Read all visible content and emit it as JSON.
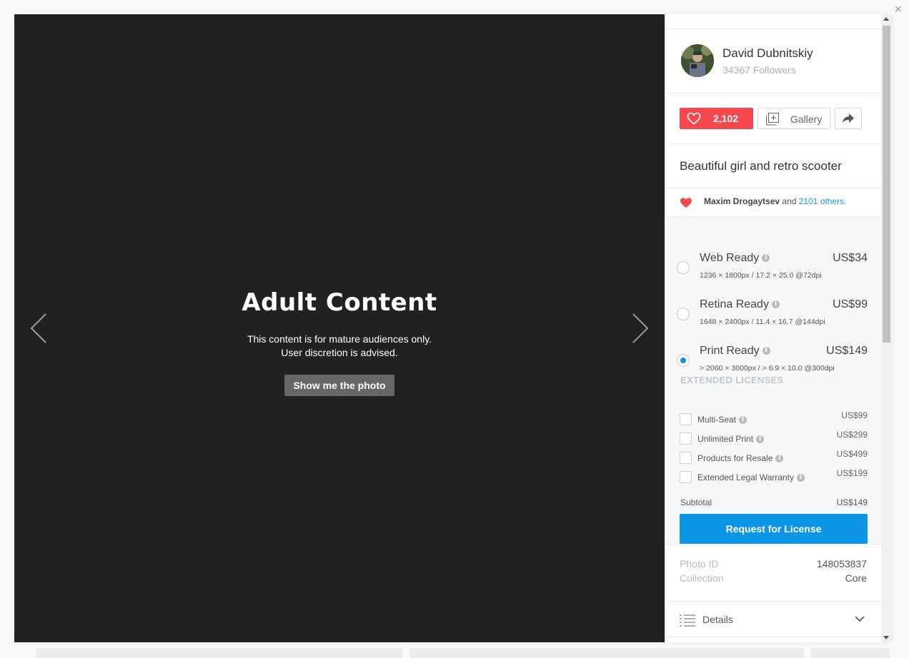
{
  "close_label": "×",
  "viewer": {
    "title": "Adult Content",
    "line1": "This content is for mature audiences only.",
    "line2": "User discretion is advised.",
    "button": "Show me the photo"
  },
  "author": {
    "name": "David Dubnitskiy",
    "followers": "34367 Followers"
  },
  "actions": {
    "likes": "2,102",
    "gallery": "Gallery"
  },
  "photo": {
    "title": "Beautiful girl and retro scooter"
  },
  "liked_by": {
    "name": "Maxim Drogaytsev",
    "and": "and",
    "others": "2101 others."
  },
  "licenses": [
    {
      "name": "Web Ready",
      "spec": "1236 × 1800px / 17.2 × 25.0 @72dpi",
      "price": "US$34",
      "selected": false
    },
    {
      "name": "Retina Ready",
      "spec": "1648 × 2400px / 11.4 × 16.7 @144dpi",
      "price": "US$99",
      "selected": false
    },
    {
      "name": "Print Ready",
      "spec": "> 2060 × 3000px / > 6.9 × 10.0 @300dpi",
      "price": "US$149",
      "selected": true
    }
  ],
  "extended": {
    "heading": "EXTENDED LICENSES",
    "items": [
      {
        "name": "Multi-Seat",
        "price": "US$99"
      },
      {
        "name": "Unlimited Print",
        "price": "US$299"
      },
      {
        "name": "Products for Resale",
        "price": "US$499"
      },
      {
        "name": "Extended Legal Warranty",
        "price": "US$199"
      }
    ]
  },
  "subtotal": {
    "label": "Subtotal",
    "value": "US$149"
  },
  "request_button": "Request for License",
  "meta": {
    "photo_id_label": "Photo ID",
    "photo_id": "148053837",
    "collection_label": "Collection",
    "collection": "Core"
  },
  "details_label": "Details",
  "colors": {
    "like": "#f2484e",
    "primary": "#0d96e6",
    "viewer_bg": "#212121"
  }
}
